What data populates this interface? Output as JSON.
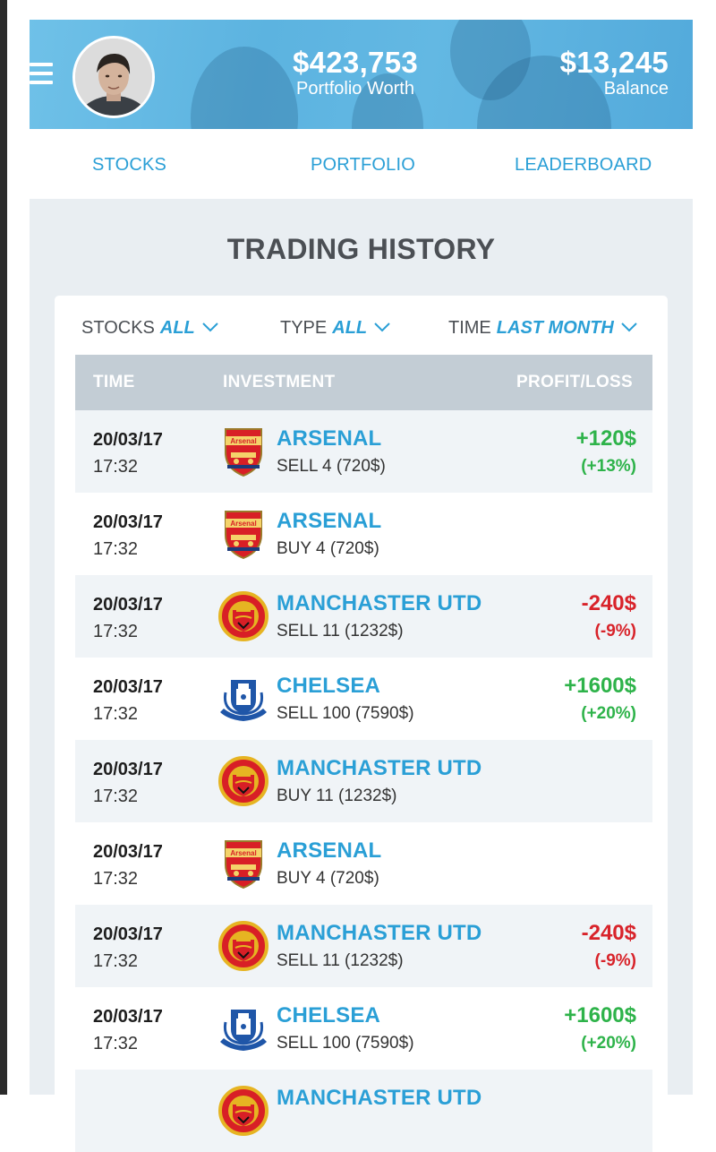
{
  "header": {
    "portfolio_worth_value": "$423,753",
    "portfolio_worth_label": "Portfolio Worth",
    "balance_value": "$13,245",
    "balance_label": "Balance"
  },
  "tabs": [
    {
      "label": "STOCKS"
    },
    {
      "label": "PORTFOLIO"
    },
    {
      "label": "LEADERBOARD"
    }
  ],
  "page_title": "TRADING HISTORY",
  "filters": {
    "stocks": {
      "label": "STOCKS",
      "value": "ALL"
    },
    "type": {
      "label": "TYPE",
      "value": "ALL"
    },
    "time": {
      "label": "TIME",
      "value": "LAST MONTH"
    }
  },
  "table": {
    "headers": {
      "time": "TIME",
      "investment": "INVESTMENT",
      "profit_loss": "PROFIT/LOSS"
    },
    "rows": [
      {
        "date": "20/03/17",
        "time": "17:32",
        "club": "arsenal",
        "team": "ARSENAL",
        "action": "SELL 4 (720$)",
        "amount": "+120$",
        "percent": "(+13%)",
        "sign": "pos"
      },
      {
        "date": "20/03/17",
        "time": "17:32",
        "club": "arsenal",
        "team": "ARSENAL",
        "action": "BUY 4 (720$)",
        "amount": "",
        "percent": "",
        "sign": ""
      },
      {
        "date": "20/03/17",
        "time": "17:32",
        "club": "manutd",
        "team": "MANCHASTER UTD",
        "action": "SELL 11 (1232$)",
        "amount": "-240$",
        "percent": "(-9%)",
        "sign": "neg"
      },
      {
        "date": "20/03/17",
        "time": "17:32",
        "club": "chelsea",
        "team": "CHELSEA",
        "action": "SELL 100 (7590$)",
        "amount": "+1600$",
        "percent": "(+20%)",
        "sign": "pos"
      },
      {
        "date": "20/03/17",
        "time": "17:32",
        "club": "manutd",
        "team": "MANCHASTER UTD",
        "action": "BUY 11 (1232$)",
        "amount": "",
        "percent": "",
        "sign": ""
      },
      {
        "date": "20/03/17",
        "time": "17:32",
        "club": "arsenal",
        "team": "ARSENAL",
        "action": "BUY 4 (720$)",
        "amount": "",
        "percent": "",
        "sign": ""
      },
      {
        "date": "20/03/17",
        "time": "17:32",
        "club": "manutd",
        "team": "MANCHASTER UTD",
        "action": "SELL 11 (1232$)",
        "amount": "-240$",
        "percent": "(-9%)",
        "sign": "neg"
      },
      {
        "date": "20/03/17",
        "time": "17:32",
        "club": "chelsea",
        "team": "CHELSEA",
        "action": "SELL 100 (7590$)",
        "amount": "+1600$",
        "percent": "(+20%)",
        "sign": "pos"
      },
      {
        "date": "",
        "time": "",
        "club": "manutd",
        "team": "MANCHASTER UTD",
        "action": "",
        "amount": "",
        "percent": "",
        "sign": ""
      }
    ]
  },
  "colors": {
    "accent": "#2a9fd6",
    "header_blue": "#5cb3e0",
    "profit": "#2eb34a",
    "loss": "#d8232a",
    "page_bg": "#e9eef2",
    "table_header": "#c3cdd5"
  },
  "icons": {
    "menu": "hamburger-menu-icon",
    "filter_chevron": "chevron-down-icon",
    "club_crest": "club-crest-icon"
  }
}
